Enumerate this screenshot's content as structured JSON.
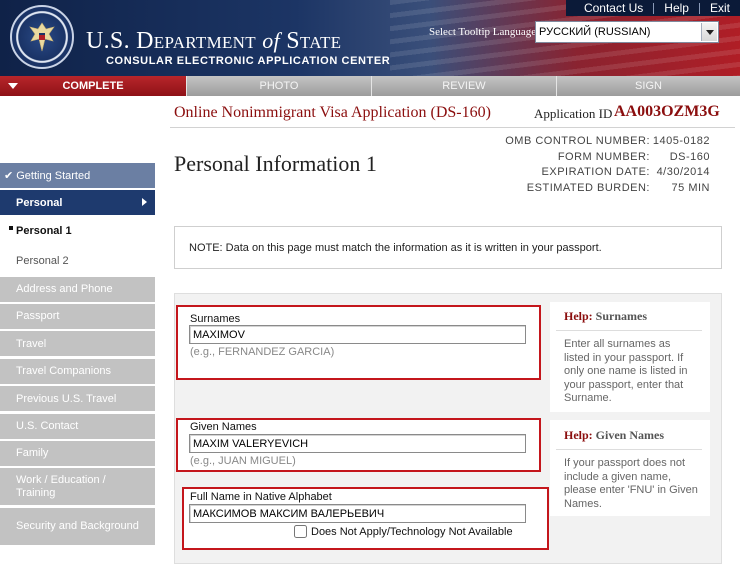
{
  "header": {
    "top_links": [
      "Contact Us",
      "Help",
      "Exit"
    ],
    "agency_prefix": "U.S. Department",
    "agency_of": "of",
    "agency_suffix": "State",
    "subagency": "CONSULAR ELECTRONIC APPLICATION CENTER",
    "tooltip_label": "Select Tooltip Language",
    "language_value": "РУССКИЙ (RUSSIAN)"
  },
  "progress": {
    "steps": [
      "COMPLETE",
      "PHOTO",
      "REVIEW",
      "SIGN"
    ]
  },
  "app": {
    "title": "Online Nonimmigrant Visa Application (DS-160)",
    "id_label": "Application ID",
    "id_value": "AA003OZM3G"
  },
  "omb": [
    {
      "k": "OMB CONTROL NUMBER:",
      "v": "1405-0182"
    },
    {
      "k": "FORM NUMBER:",
      "v": "DS-160"
    },
    {
      "k": "EXPIRATION DATE:",
      "v": "4/30/2014"
    },
    {
      "k": "ESTIMATED BURDEN:",
      "v": "75 MIN"
    }
  ],
  "page_title": "Personal Information 1",
  "sidebar": {
    "items": [
      "Getting Started",
      "Personal",
      "Personal 1",
      "Personal 2",
      "Address and Phone",
      "Passport",
      "Travel",
      "Travel Companions",
      "Previous U.S. Travel",
      "U.S. Contact",
      "Family",
      "Work / Education / Training",
      "Security and Background"
    ]
  },
  "note": "NOTE: Data on this page must match the information as it is written in your passport.",
  "form": {
    "surnames": {
      "label": "Surnames",
      "value": "MAXIMOV",
      "hint": "(e.g., FERNANDEZ GARCIA)"
    },
    "given_names": {
      "label": "Given Names",
      "value": "MAXIM VALERYEVICH",
      "hint": "(e.g., JUAN MIGUEL)"
    },
    "native_name": {
      "label": "Full Name in Native Alphabet",
      "value": "МАКСИМОВ МАКСИМ ВАЛЕРЬЕВИЧ",
      "na_label": "Does Not Apply/Technology Not Available"
    }
  },
  "help": {
    "word": "Help:",
    "surnames_title": "Surnames",
    "surnames_text": "Enter all surnames as listed in your passport. If only one name is listed in your passport, enter that Surname.",
    "given_title": "Given Names",
    "given_text": "If your passport does not include a given name, please enter 'FNU' in Given Names."
  },
  "colors": {
    "header_navy": "#1c3565",
    "brand_red": "#8b0e0e",
    "highlight_red": "#c4161c",
    "nav_current": "#1e3a6e",
    "nav_done": "#6b7fa3",
    "nav_inactive": "#c2c2c2"
  }
}
